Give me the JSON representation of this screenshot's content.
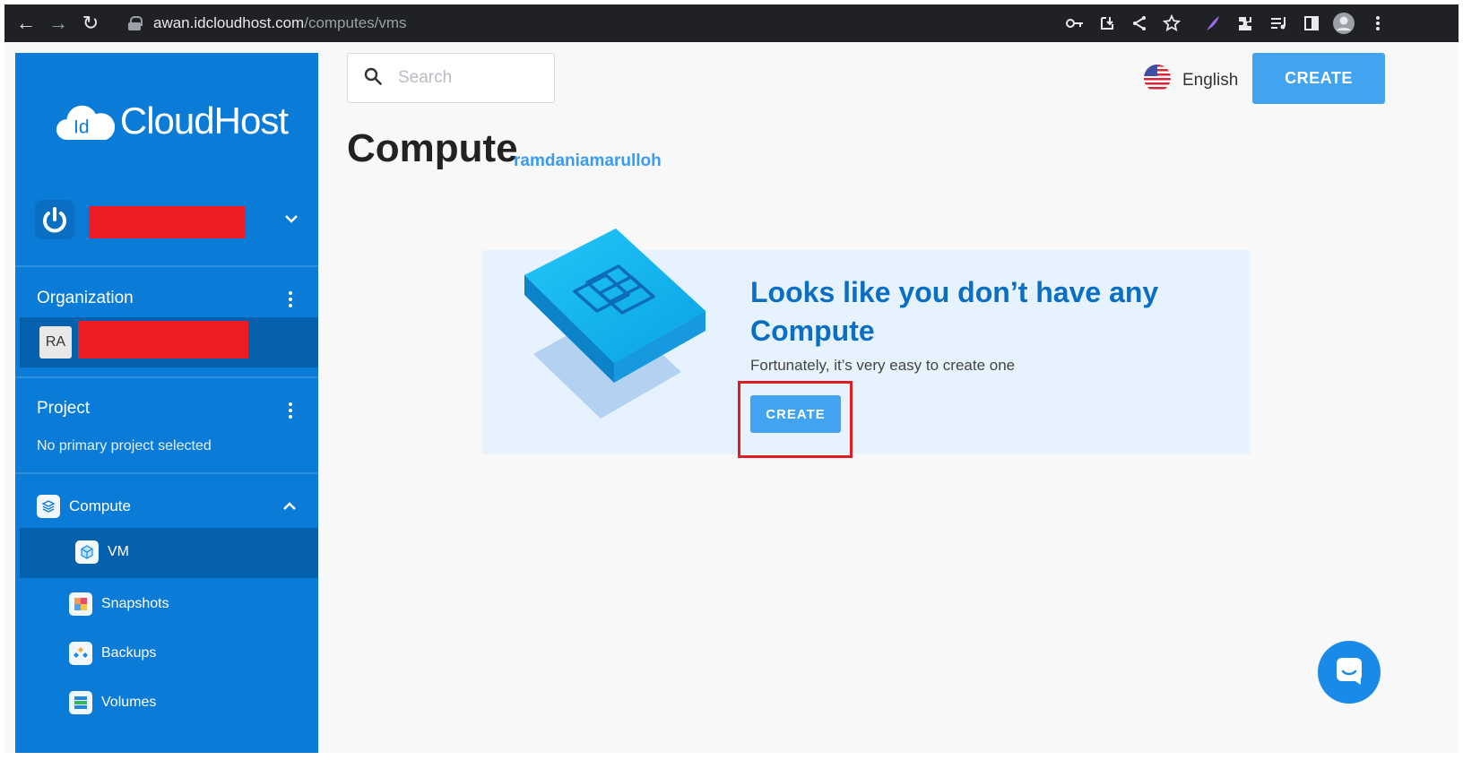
{
  "browser": {
    "url_host": "awan.idcloudhost.com",
    "url_path": "/computes/vms"
  },
  "sidebar": {
    "logo_mark": "Id",
    "logo_text": "CloudHost",
    "organization_title": "Organization",
    "org_initials": "RA",
    "project_title": "Project",
    "project_status": "No primary project selected",
    "menu": {
      "compute": "Compute",
      "vm": "VM",
      "snapshots": "Snapshots",
      "backups": "Backups",
      "volumes": "Volumes"
    }
  },
  "header": {
    "search_placeholder": "Search",
    "language": "English",
    "create_label": "CREATE"
  },
  "main": {
    "title": "Compute",
    "username": "ramdaniamarulloh",
    "empty_title": "Looks like you don’t have any Compute",
    "empty_subtitle": "Fortunately, it’s very easy to create one",
    "create_label": "CREATE"
  },
  "colors": {
    "sidebar": "#0b7bd8",
    "accent": "#42a3f0",
    "heading": "#0a6ec3",
    "highlight": "#e01b24"
  }
}
